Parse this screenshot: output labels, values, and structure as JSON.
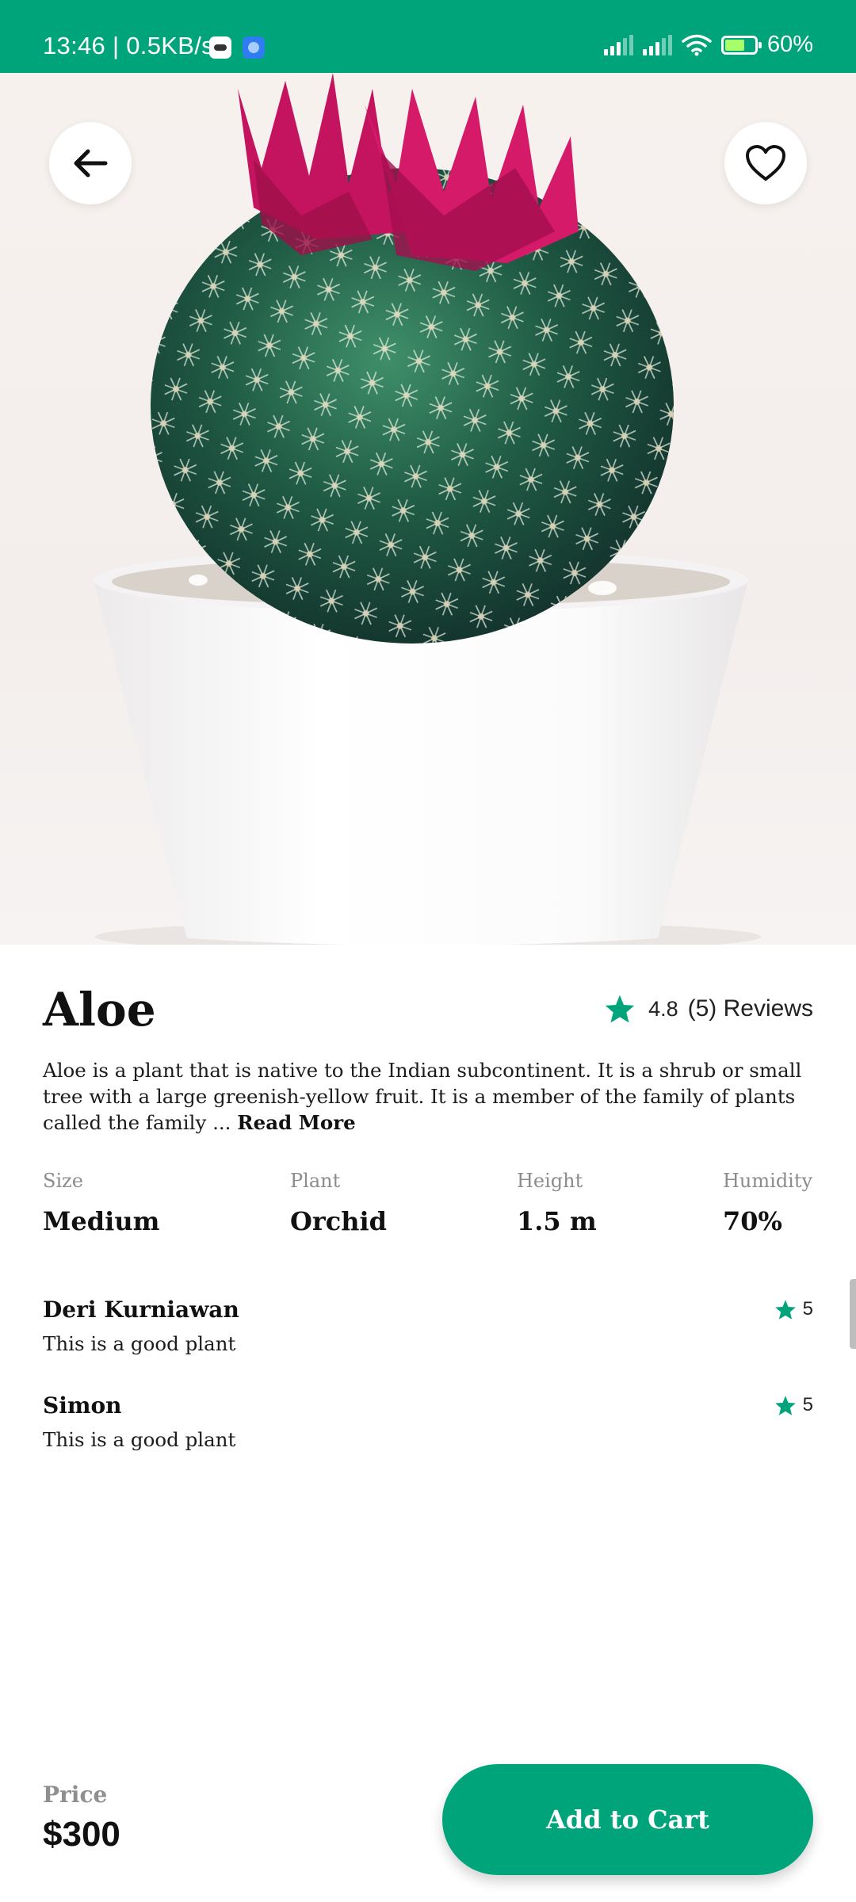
{
  "colors": {
    "accent": "#00a47a",
    "star": "#00a47a"
  },
  "status_bar": {
    "time_speed": "13:46 | 0.5KB/s",
    "battery": "60%",
    "icons": [
      "signal-icon",
      "signal-icon",
      "wifi-icon",
      "battery-charging-icon"
    ]
  },
  "hero": {
    "back_icon": "arrow-left-icon",
    "favorite_icon": "heart-outline-icon"
  },
  "product": {
    "name": "Aloe",
    "rating": "4.8",
    "reviews": "(5) Reviews",
    "description": "Aloe is a plant that is native to the Indian subcontinent. It is a shrub or small tree with a large greenish-yellow fruit. It is a member of the family of plants called the family ...",
    "read_more": "Read More"
  },
  "specs": [
    {
      "label": "Size",
      "value": "Medium"
    },
    {
      "label": "Plant",
      "value": "Orchid"
    },
    {
      "label": "Height",
      "value": "1.5 m"
    },
    {
      "label": "Humidity",
      "value": "70%"
    }
  ],
  "reviews": [
    {
      "name": "Deri Kurniawan",
      "text": "This is a good plant",
      "rating": "5"
    },
    {
      "name": "Simon",
      "text": "This is a good plant",
      "rating": "5"
    }
  ],
  "footer": {
    "price_label": "Price",
    "price": "$300",
    "add_to_cart": "Add to Cart"
  }
}
